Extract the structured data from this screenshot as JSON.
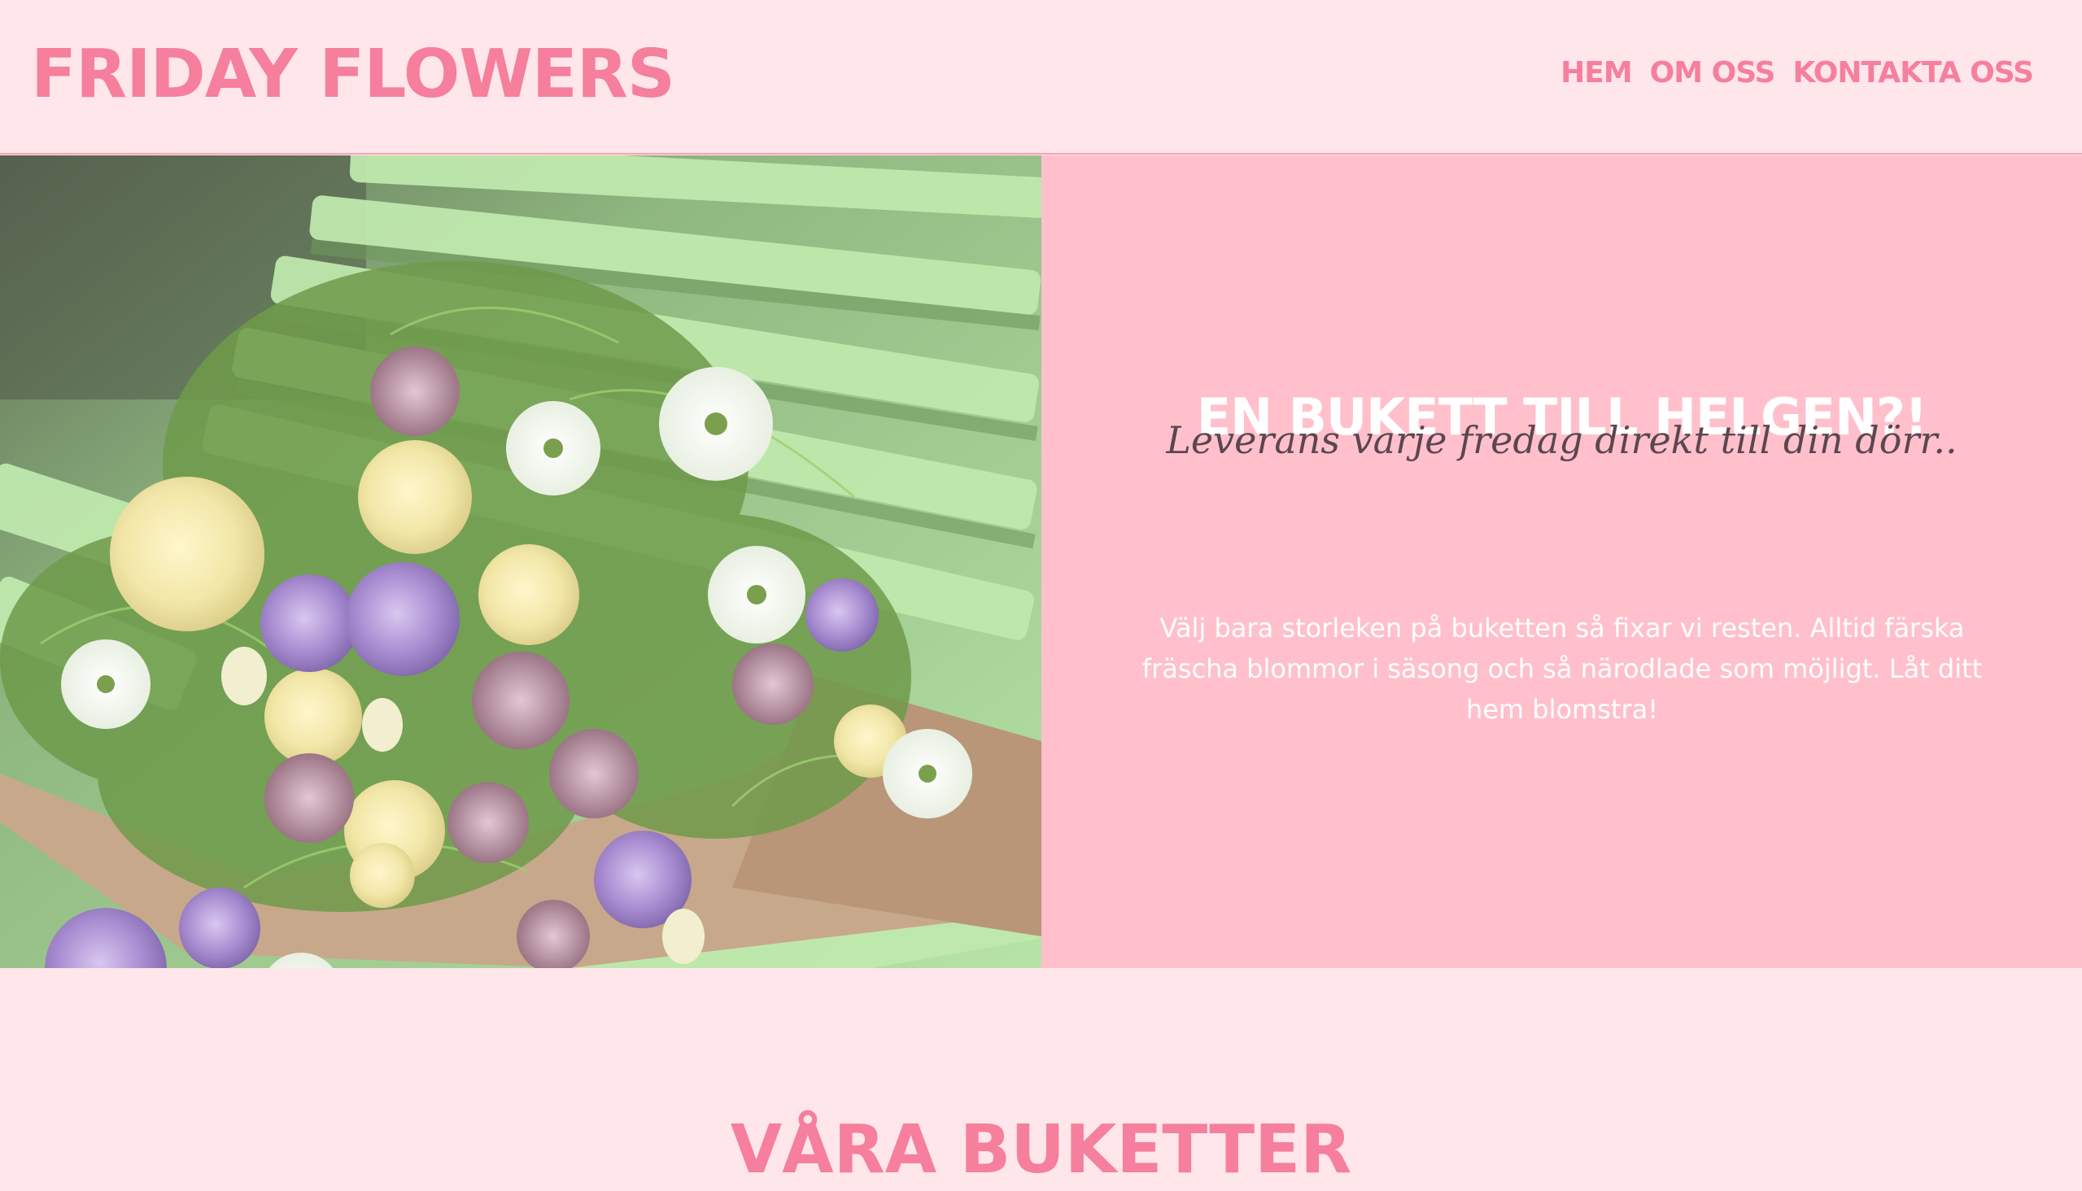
{
  "header": {
    "logo": "FRIDAY FLOWERS",
    "nav": [
      {
        "label": "HEM"
      },
      {
        "label": "OM OSS"
      },
      {
        "label": "KONTAKTA OSS"
      }
    ]
  },
  "hero": {
    "image": {
      "subject": "flower bouquet wrapped in kraft paper on a light green bench"
    },
    "title": "EN BUKETT TILL HELGEN?!",
    "subtitle": "Leverans varje fredag direkt till din dörr..",
    "body": "Välj bara storleken på buketten så fixar vi resten. Alltid färska fräscha blommor i säsong och så närodlade som möjligt. Låt ditt hem blomstra!"
  },
  "section": {
    "title": "VÅRA BUKETTER"
  },
  "colors": {
    "background": "#ffe6ea",
    "brand_pink": "#f57f9c",
    "panel_pink": "#ffc0cc",
    "bench_green": "#a8d99a"
  }
}
